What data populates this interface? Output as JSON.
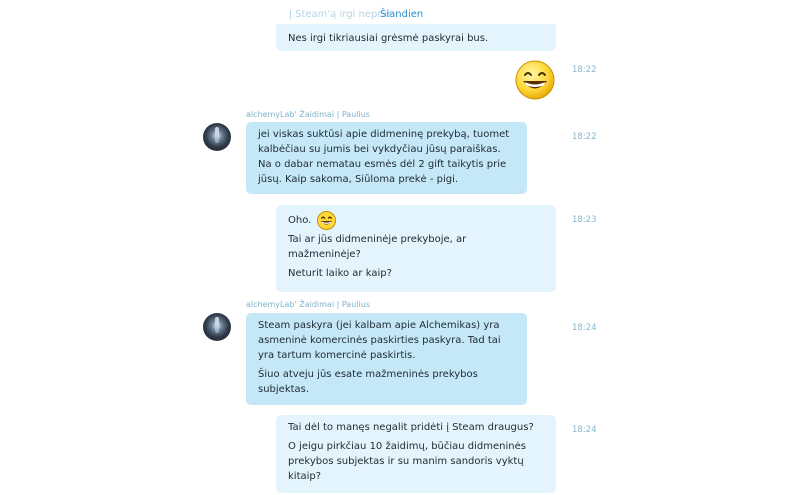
{
  "date_divider": "Šiandien",
  "ghost_text": "Į Steam'ą irgi neprie",
  "messages": [
    {
      "kind": "out",
      "lines": [
        "Nes irgi tikriausiai grėsmė paskyrai bus."
      ],
      "time": ""
    },
    {
      "kind": "out-emoji",
      "emoji": "grinning-smiley",
      "time": "18:22"
    },
    {
      "kind": "in",
      "sender": "alchemyLab' Žaidimai | Paulius",
      "paragraphs": [
        [
          "jei viskas suktūsi apie didmeninę prekybą, tuomet",
          "kalbėčiau su jumis bei vykdyčiau jūsų paraiškas.",
          "Na o dabar nematau esmės dėl 2 gift taikytis prie",
          "jūsų. Kaip sakoma, Siūloma prekė - pigi."
        ]
      ],
      "time": "18:22"
    },
    {
      "kind": "out",
      "first": "Oho.",
      "paragraphs": [
        [
          "Tai ar jūs didmeninėje prekyboje, ar",
          "mažmeninėje?"
        ],
        [
          "Neturit laiko ar kaip?"
        ]
      ],
      "time": "18:23"
    },
    {
      "kind": "in",
      "sender": "alchemyLab' Žaidimai | Paulius",
      "paragraphs": [
        [
          "Steam paskyra (jei kalbam apie Alchemikas) yra",
          "asmeninė komercinės paskirties paskyra. Tad tai",
          "yra tartum komercinė paskirtis."
        ],
        [
          "Šiuo atveju jūs esate mažmeninės prekybos",
          "subjektas."
        ]
      ],
      "time": "18:24"
    },
    {
      "kind": "out",
      "paragraphs": [
        [
          "Tai dėl to manęs negalit pridėti į Steam draugus?"
        ],
        [
          "O jeigu pirkčiau 10 žaidimų, būčiau didmeninės",
          "prekybos subjektas ir su manim sandoris vyktų",
          "kitaip?"
        ]
      ],
      "time": "18:24"
    }
  ]
}
